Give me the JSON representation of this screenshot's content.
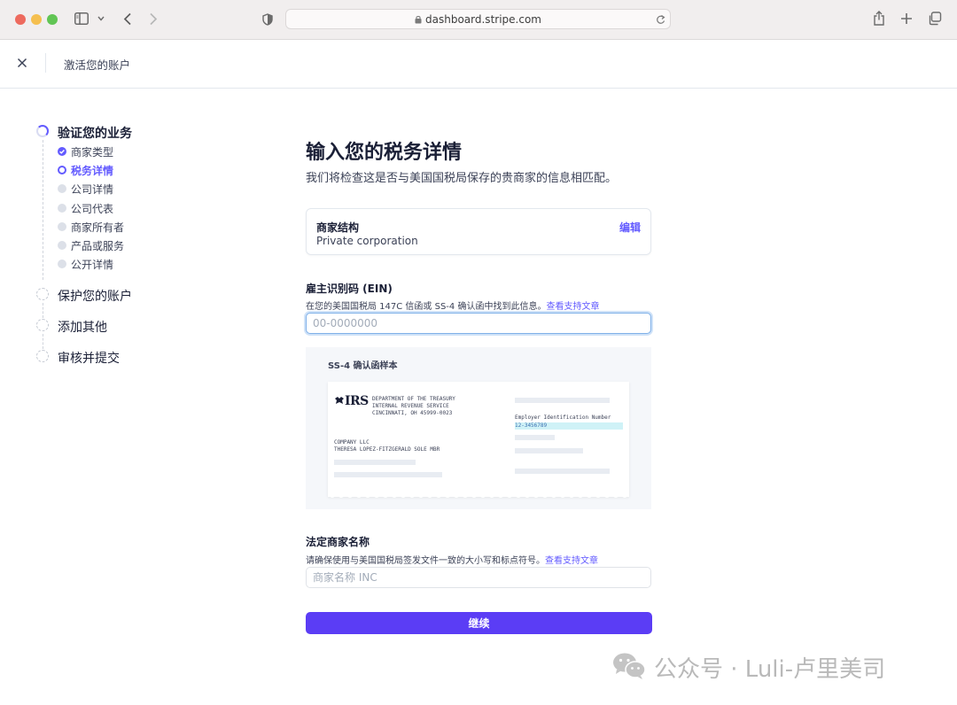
{
  "browser": {
    "url": "dashboard.stripe.com"
  },
  "header": {
    "title": "激活您的账户"
  },
  "stepper": {
    "sections": [
      {
        "label": "验证您的业务",
        "state": "in-progress"
      },
      {
        "label": "保护您的账户",
        "state": "todo"
      },
      {
        "label": "添加其他",
        "state": "todo"
      },
      {
        "label": "审核并提交",
        "state": "todo"
      }
    ],
    "substeps": [
      {
        "label": "商家类型",
        "state": "done"
      },
      {
        "label": "税务详情",
        "state": "active"
      },
      {
        "label": "公司详情",
        "state": "todo"
      },
      {
        "label": "公司代表",
        "state": "todo"
      },
      {
        "label": "商家所有者",
        "state": "todo"
      },
      {
        "label": "产品或服务",
        "state": "todo"
      },
      {
        "label": "公开详情",
        "state": "todo"
      }
    ]
  },
  "form": {
    "title": "输入您的税务详情",
    "subtitle": "我们将检查这是否与美国国税局保存的贵商家的信息相匹配。",
    "structure": {
      "label": "商家结构",
      "value": "Private corporation",
      "edit_label": "编辑"
    },
    "ein": {
      "label": "雇主识别码 (EIN)",
      "help": "在您的美国国税局 147C 信函或 SS-4 确认函中找到此信息。",
      "help_link": "查看支持文章",
      "placeholder": "00-0000000"
    },
    "sample": {
      "title": "SS-4 确认函样本",
      "logo": "IRS",
      "agency": [
        "DEPARTMENT OF THE TREASURY",
        "INTERNAL REVENUE SERVICE",
        "CINCINNATI, OH 45999-0023"
      ],
      "recipient": [
        "COMPANY LLC",
        "THERESA LOPEZ-FITZGERALD SOLE MBR"
      ],
      "ein_label": "Employer Identification Number",
      "ein_value": "12-3456789"
    },
    "legal_name": {
      "label": "法定商家名称",
      "help": "请确保使用与美国国税局签发文件一致的大小写和标点符号。",
      "help_link": "查看支持文章",
      "placeholder": "商家名称 INC"
    },
    "submit_label": "继续"
  },
  "watermark": {
    "text": "公众号 · Luli-卢里美司"
  },
  "colors": {
    "accent": "#635bff",
    "button": "#5b3df5",
    "text": "#1a1f36"
  }
}
